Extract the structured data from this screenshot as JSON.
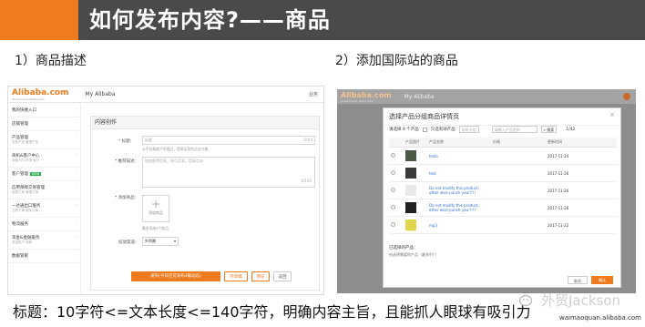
{
  "title": "如何发布内容?——商品",
  "subtitles": {
    "left": "1）商品描述",
    "right": "2）添加国际站的商品"
  },
  "left_shot": {
    "logo": "Alibaba.com",
    "logo_sub": "Global trade starts here",
    "my": "My Alibaba",
    "top_right": "业务",
    "sidebar": [
      {
        "label": "我的快捷入口",
        "sub": ""
      },
      {
        "label": "店铺管理",
        "sub": ""
      },
      {
        "label": "产品管理",
        "sub": "发布产品  管理产品"
      },
      {
        "label": "商机&客户中心",
        "sub": "询盘  RFQ市场  客户"
      },
      {
        "label": "客户管理",
        "sub": "",
        "badge": "NEW"
      },
      {
        "label": "信用保障交易管理",
        "sub": "起草订单  管理订单"
      },
      {
        "label": "一达通出口服务",
        "sub": "立即下单  服务订单"
      },
      {
        "label": "物流服务",
        "sub": ""
      },
      {
        "label": "资金&金融服务",
        "sub": "资金账户  收款"
      },
      {
        "label": "数据管家",
        "sub": ""
      }
    ],
    "panel_title": "内容创作",
    "form": {
      "title_label": "* 标题：",
      "title_placeholder": "标题",
      "title_count": "0/44",
      "title_hint": "从不同角度介绍商品，提高买家的点击兴趣",
      "summary_label": "* 推荐描述：",
      "summary_placeholder": "增加推荐信息，吸引买家，提高点击",
      "summary_count": "0/140",
      "product_label": "* 添加商品：",
      "upload_label": "添加商品",
      "upload_hint": "最多添加9个商品",
      "channel_label": "投放渠道：",
      "channel_value": "外贸圈"
    },
    "buttons": {
      "publish": "发布(今日还可发布4篇动态)",
      "save": "存草稿",
      "preview": "预览",
      "back": "返回"
    }
  },
  "right_shot": {
    "logo": "Alibaba.com",
    "logo_sub": "Global trade starts here",
    "my": "My Alibaba",
    "modal_title": "选择产品分组商品详情页",
    "filter_label": "请选择 9 个产品",
    "filter_only": "只选有效产品",
    "filter_group": "所有分组",
    "search_placeholder": "请输入产品名称",
    "search_button": "搜索",
    "page": "1/42",
    "columns": [
      "产品图片",
      "产品名称",
      "价格",
      "更新时间"
    ],
    "rows": [
      {
        "name": "hello",
        "price": "",
        "date": "2017-11-24"
      },
      {
        "name": "test",
        "price": "",
        "date": "2017-11-26"
      },
      {
        "name": "Do not modify this product, other wise punch you!!!!!",
        "price": "",
        "date": "2017-11-26"
      },
      {
        "name": "Do not modify this product, other wise punch you!!!!!",
        "price": "",
        "date": "2017-11-26"
      },
      {
        "name": "mp3",
        "price": "",
        "date": "2017-11-22"
      }
    ],
    "selected_label": "已选择的产品：",
    "selected_sub": "给选择需要的产品（最多9个）",
    "cancel": "取消",
    "ok": "确认"
  },
  "caption": "标题：10字符<=文本长度<=140字符，明确内容主旨，且能抓人眼球有吸引力",
  "watermark": {
    "text": "外贸Jackson",
    "url": "waimaoquan.alibaba.com"
  }
}
